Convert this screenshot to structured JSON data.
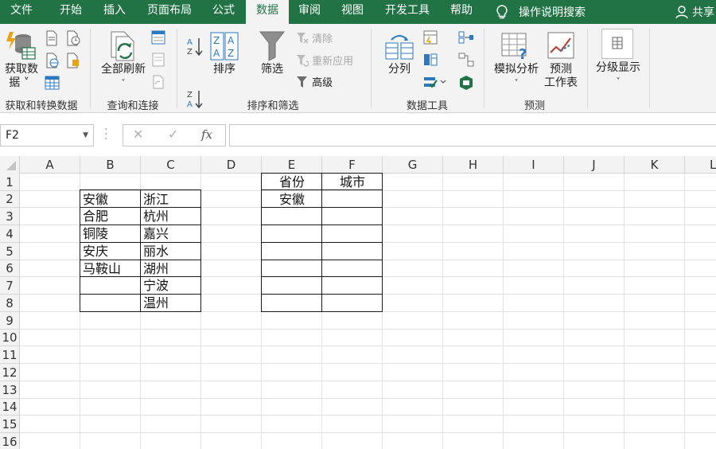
{
  "tabs": [
    "文件",
    "开始",
    "插入",
    "页面布局",
    "公式",
    "数据",
    "审阅",
    "视图",
    "开发工具",
    "帮助"
  ],
  "tell_me": "操作说明搜索",
  "share": "共享",
  "ribbon": {
    "get_data": {
      "label_line1": "获取数",
      "label_line2": "据",
      "group": "获取和转换数据"
    },
    "refresh": {
      "label": "全部刷新",
      "group": "查询和连接"
    },
    "sort_filter": {
      "sort": "排序",
      "filter": "筛选",
      "clear": "清除",
      "reapply": "重新应用",
      "advanced": "高级",
      "group": "排序和筛选"
    },
    "data_tools": {
      "text_to_columns": "分列",
      "group": "数据工具"
    },
    "forecast": {
      "what_if": "模拟分析",
      "sheet_line1": "预测",
      "sheet_line2": "工作表",
      "group": "预测"
    },
    "outline": {
      "label": "分级显示"
    }
  },
  "formula_bar": {
    "name_box": "F2",
    "cancel": "✕",
    "enter": "✓",
    "fx": "fx",
    "content": ""
  },
  "columns": [
    "A",
    "B",
    "C",
    "D",
    "E",
    "F",
    "G",
    "H",
    "I",
    "J",
    "K",
    "L"
  ],
  "rows": [
    "1",
    "2",
    "3",
    "4",
    "5",
    "6",
    "7",
    "8",
    "9",
    "10",
    "11",
    "12",
    "13",
    "14",
    "15",
    "16"
  ],
  "cells": {
    "B2": "安徽",
    "B3": "合肥",
    "B4": "铜陵",
    "B5": "安庆",
    "B6": "马鞍山",
    "C2": "浙江",
    "C3": "杭州",
    "C4": "嘉兴",
    "C5": "丽水",
    "C6": "湖州",
    "C7": "宁波",
    "C8": "温州",
    "E1": "省份",
    "F1": "城市",
    "E2": "安徽"
  },
  "colors": {
    "excel_green": "#217346",
    "ribbon_bg": "#f3f3f3",
    "grid_line": "#e1e1e1"
  },
  "icons": [
    "get-data-icon",
    "refresh-all-icon",
    "sort-asc-icon",
    "sort-desc-icon",
    "sort-icon",
    "filter-icon",
    "clear-icon",
    "reapply-icon",
    "advanced-filter-icon",
    "text-to-columns-icon",
    "what-if-icon",
    "forecast-sheet-icon",
    "outline-icon",
    "lightbulb-icon",
    "person-icon"
  ]
}
